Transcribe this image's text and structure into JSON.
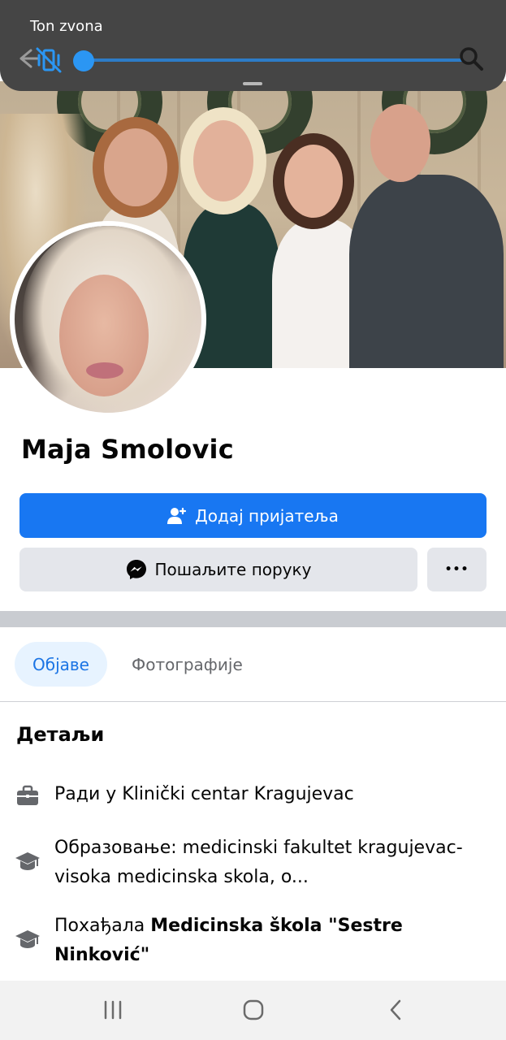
{
  "volume_panel": {
    "title": "Ton zvona",
    "level": 0.0,
    "accent_color": "#2b96f3"
  },
  "profile": {
    "name": "Maja Smolovic"
  },
  "actions": {
    "add_friend_label": "Додај пријатеља",
    "message_label": "Пошаљите поруку",
    "more_label": "•••"
  },
  "tabs": [
    {
      "label": "Објаве",
      "active": true
    },
    {
      "label": "Фотографије",
      "active": false
    }
  ],
  "details": {
    "title": "Детаљи",
    "work": {
      "prefix": "Ради у",
      "value": "Klinički centar Kragujevac"
    },
    "education": {
      "text": "Образовање: medicinski fakultet kragujevac-visoka medicinska skola, o..."
    },
    "school": {
      "prefix": "Похађала",
      "value": "Medicinska škola \"Sestre Ninković\""
    }
  },
  "colors": {
    "brand_blue": "#1877f2",
    "button_gray": "#e4e6eb",
    "tab_active_bg": "#e7f3ff",
    "tab_active_text": "#1b74e4"
  },
  "icons": {
    "back": "arrow-left-icon",
    "mute": "vibrate-mute-icon",
    "search": "search-icon",
    "add_friend": "person-add-icon",
    "messenger": "messenger-icon",
    "more": "more-icon",
    "work": "briefcase-icon",
    "education": "graduation-cap-icon",
    "school": "graduation-cap-icon",
    "nav_recents": "recents-icon",
    "nav_home": "home-icon",
    "nav_back": "back-icon"
  }
}
